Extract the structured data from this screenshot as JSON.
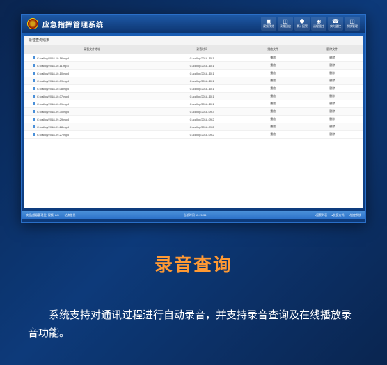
{
  "app": {
    "title": "应急指挥管理系统",
    "content_header": "录音查询结果"
  },
  "toolbar": [
    {
      "label": "视频预览",
      "glyph": "▣"
    },
    {
      "label": "录像回放",
      "glyph": "◫"
    },
    {
      "label": "累计报警",
      "glyph": "⬢"
    },
    {
      "label": "远程遥控",
      "glyph": "◉"
    },
    {
      "label": "实时监控",
      "glyph": "☎"
    },
    {
      "label": "系统管理",
      "glyph": "◫"
    }
  ],
  "table": {
    "headers": [
      "录音文件地址",
      "录音时间",
      "播放文件",
      "删除文件"
    ],
    "rows": [
      {
        "file": "C:/callog/2018-10-16.mp3",
        "time": "C:/callog/2018-10-1",
        "play": "播放",
        "delete": "删除"
      },
      {
        "file": "C:/callog/2018-10-11.mp3",
        "time": "C:/callog/2018-10-1",
        "play": "播放",
        "delete": "删除"
      },
      {
        "file": "C:/callog/2018-10-10.mp3",
        "time": "C:/callog/2018-10-1",
        "play": "播放",
        "delete": "删除"
      },
      {
        "file": "C:/callog/2018-10-09.mp3",
        "time": "C:/callog/2018-10-1",
        "play": "播放",
        "delete": "删除"
      },
      {
        "file": "C:/callog/2018-10-08.mp3",
        "time": "C:/callog/2018-10-1",
        "play": "播放",
        "delete": "删除"
      },
      {
        "file": "C:/callog/2018-10-07.mp3",
        "time": "C:/callog/2018-10-1",
        "play": "播放",
        "delete": "删除"
      },
      {
        "file": "C:/callog/2018-10-01.mp3",
        "time": "C:/callog/2018-10-1",
        "play": "播放",
        "delete": "删除"
      },
      {
        "file": "C:/callog/2018-09-30.mp3",
        "time": "C:/callog/2018-09-3",
        "play": "播放",
        "delete": "删除"
      },
      {
        "file": "C:/callog/2018-09-29.mp3",
        "time": "C:/callog/2018-09-2",
        "play": "播放",
        "delete": "删除"
      },
      {
        "file": "C:/callog/2018-09-28.mp3",
        "time": "C:/callog/2018-09-2",
        "play": "播放",
        "delete": "删除"
      },
      {
        "file": "C:/callog/2018-09-27.mp3",
        "time": "C:/callog/2018-09-2",
        "play": "播放",
        "delete": "删除"
      }
    ]
  },
  "status": {
    "left1": "欢迎(超级管理员) 视频: 8/8",
    "left2": "站点信息",
    "center": "当前时间 15:21:34",
    "right1": "●报警列表",
    "right2": "●快捷方式",
    "right3": "●锁定系统"
  },
  "slide": {
    "title": "录音查询",
    "description": "系统支持对通讯过程进行自动录音，并支持录音查询及在线播放录音功能。"
  }
}
